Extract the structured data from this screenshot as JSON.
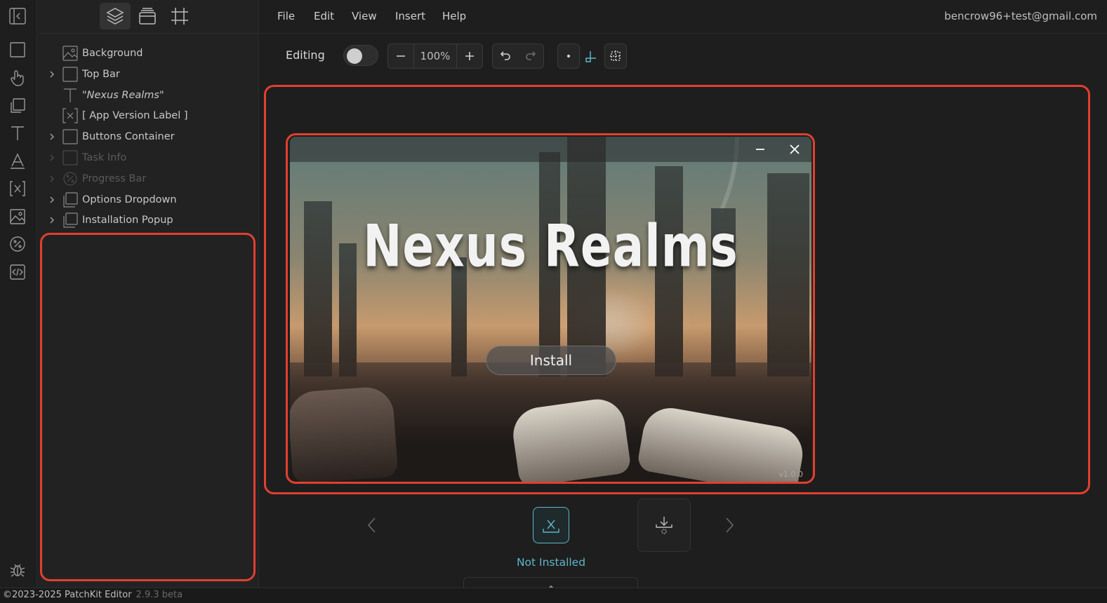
{
  "menubar": {
    "items": [
      "File",
      "Edit",
      "View",
      "Insert",
      "Help"
    ],
    "user_email": "bencrow96+test@gmail.com"
  },
  "rail": {
    "icons": [
      "collapse-panel-icon",
      "rectangle-icon",
      "hand-pointer-icon",
      "copy-shape-icon",
      "text-icon",
      "font-icon",
      "variable-icon",
      "image-icon",
      "percent-icon",
      "code-icon",
      "debug-bug-icon"
    ]
  },
  "layers_tabs": [
    "layers-icon",
    "assets-icon",
    "frame-icon"
  ],
  "layers": [
    {
      "label": "Background",
      "icon": "image-icon",
      "expandable": false,
      "dim": false,
      "italic": false
    },
    {
      "label": "Top Bar",
      "icon": "container-icon",
      "expandable": true,
      "dim": false,
      "italic": false
    },
    {
      "label": "\"Nexus Realms\"",
      "icon": "text-icon",
      "expandable": false,
      "dim": false,
      "italic": true
    },
    {
      "label": "[ App Version Label ]",
      "icon": "variable-icon",
      "expandable": false,
      "dim": false,
      "italic": false
    },
    {
      "label": "Buttons Container",
      "icon": "container-icon",
      "expandable": true,
      "dim": false,
      "italic": false
    },
    {
      "label": "Task Info",
      "icon": "container-icon",
      "expandable": true,
      "dim": true,
      "italic": false
    },
    {
      "label": "Progress Bar",
      "icon": "percent-icon",
      "expandable": true,
      "dim": true,
      "italic": false
    },
    {
      "label": "Options Dropdown",
      "icon": "stack-icon",
      "expandable": true,
      "dim": false,
      "italic": false
    },
    {
      "label": "Installation Popup",
      "icon": "stack-icon",
      "expandable": true,
      "dim": false,
      "italic": false
    }
  ],
  "toolbar": {
    "editing_label": "Editing",
    "editing_on": false,
    "zoom": "100%"
  },
  "preview": {
    "title": "Nexus Realms",
    "install_label": "Install",
    "version": "v1.0.0"
  },
  "states": {
    "current_label": "Not Installed"
  },
  "footer": {
    "copyright": "©2023-2025 PatchKit Editor",
    "version": "2.9.3 beta"
  },
  "colors": {
    "highlight": "#e0402f",
    "accent": "#5fb6c8"
  }
}
